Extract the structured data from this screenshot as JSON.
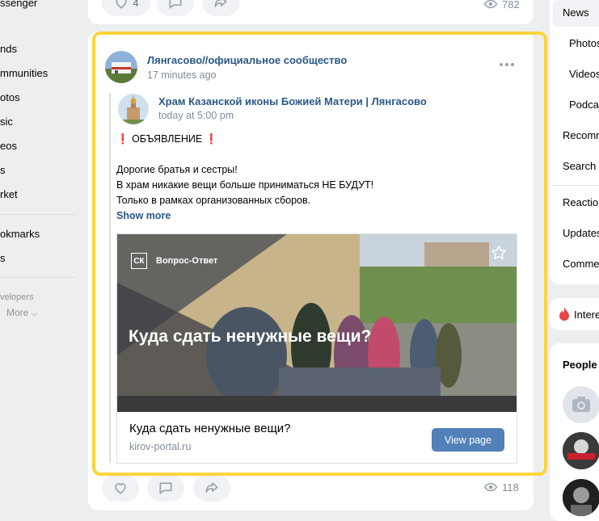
{
  "left_nav": {
    "items": [
      "ssenger",
      "nds",
      "mmunities",
      "otos",
      "sic",
      "eos",
      "s",
      "rket",
      "okmarks",
      "s"
    ],
    "developers_label": "velopers",
    "more_label": "More"
  },
  "previous_post": {
    "likes": "4",
    "views": "782"
  },
  "post": {
    "author": "Лянгасово//официальное сообщество",
    "time": "17 minutes ago",
    "repost": {
      "author": "Храм Казанской иконы Божией Матери | Лянгасово",
      "time": "today at 5:00 pm"
    },
    "excl": "❗",
    "heading": "ОБЪЯВЛЕНИЕ",
    "text_lines": [
      "Дорогие братья и сестры!",
      "В храм никакие вещи больше приниматься НЕ БУДУТ!",
      "Только в рамках организованных сборов."
    ],
    "show_more": "Show more",
    "snippet": {
      "badge": "СК",
      "badge_caption": "Вопрос-Ответ",
      "image_heading": "Куда сдать ненужные вещи?",
      "title": "Куда сдать ненужные вещи?",
      "domain": "kirov-portal.ru",
      "button": "View page"
    },
    "views": "118"
  },
  "right_nav": {
    "items": [
      "News",
      "Photos",
      "Videos",
      "Podca",
      "Recomm",
      "Search",
      "Reaction",
      "Updates",
      "Comme"
    ],
    "interests": "Intere",
    "people": "People"
  },
  "colors": {
    "link": "#2a5885",
    "accent": "#5181b8",
    "highlight": "#fdd43d"
  }
}
